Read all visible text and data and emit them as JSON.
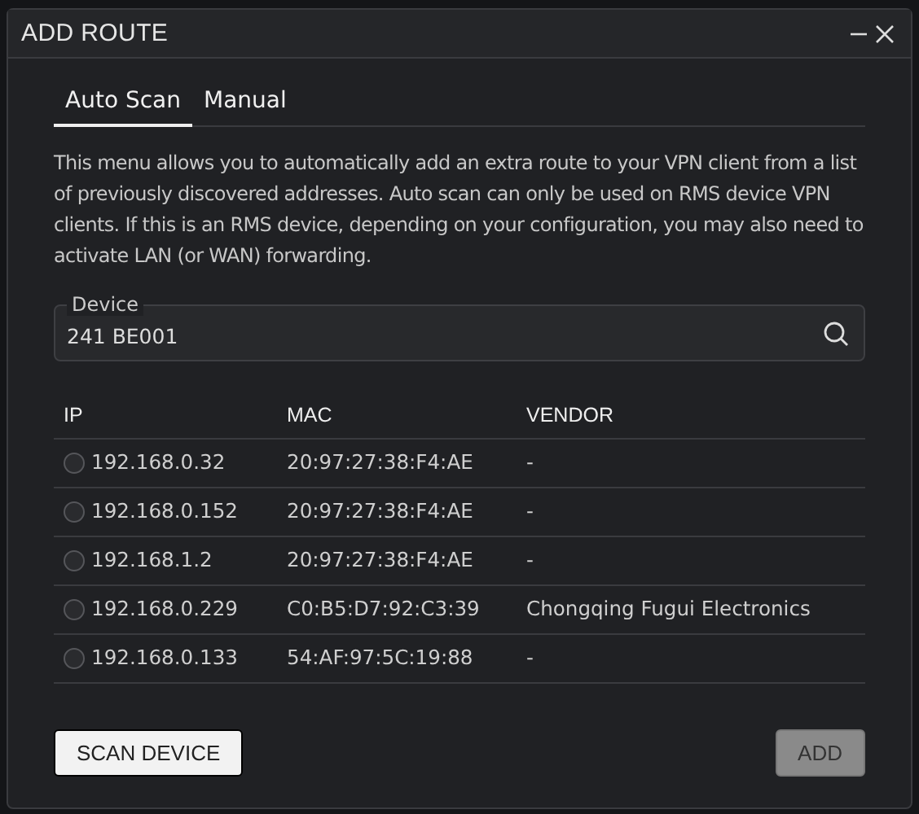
{
  "window": {
    "title": "ADD ROUTE"
  },
  "tabs": [
    {
      "label": "Auto Scan",
      "selected": true
    },
    {
      "label": "Manual",
      "selected": false
    }
  ],
  "description": "This menu allows you to automatically add an extra route to your VPN client from a list of previously discovered addresses. Auto scan can only be used on RMS device VPN clients. If this is an RMS device, depending on your configuration, you may also need to activate LAN (or WAN) forwarding.",
  "device_field": {
    "label": "Device",
    "value": "241 BE001"
  },
  "table": {
    "columns": [
      "IP",
      "MAC",
      "VENDOR"
    ],
    "rows": [
      {
        "selected": false,
        "ip": "192.168.0.32",
        "mac": "20:97:27:38:F4:AE",
        "vendor": "-"
      },
      {
        "selected": false,
        "ip": "192.168.0.152",
        "mac": "20:97:27:38:F4:AE",
        "vendor": "-"
      },
      {
        "selected": false,
        "ip": "192.168.1.2",
        "mac": "20:97:27:38:F4:AE",
        "vendor": "-"
      },
      {
        "selected": false,
        "ip": "192.168.0.229",
        "mac": "C0:B5:D7:92:C3:39",
        "vendor": "Chongqing Fugui Electronics"
      },
      {
        "selected": false,
        "ip": "192.168.0.133",
        "mac": "54:AF:97:5C:19:88",
        "vendor": "-"
      }
    ]
  },
  "buttons": [
    {
      "label": "SCAN DEVICE",
      "disabled": false
    },
    {
      "label": "ADD",
      "disabled": true
    }
  ]
}
